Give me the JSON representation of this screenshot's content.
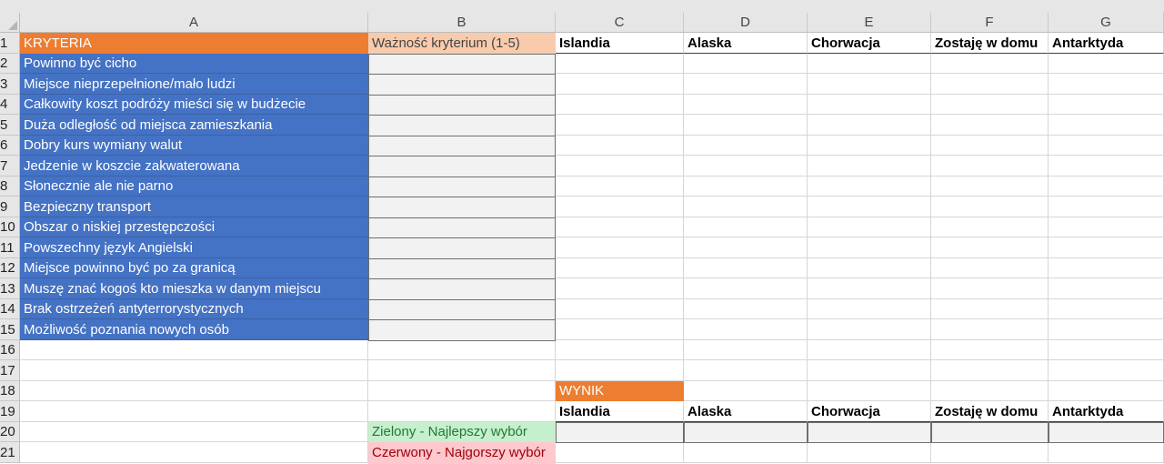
{
  "columns": [
    "A",
    "B",
    "C",
    "D",
    "E",
    "F",
    "G"
  ],
  "rows": [
    "1",
    "2",
    "3",
    "4",
    "5",
    "6",
    "7",
    "8",
    "9",
    "10",
    "11",
    "12",
    "13",
    "14",
    "15",
    "16",
    "17",
    "18",
    "19",
    "20",
    "21"
  ],
  "criteria": {
    "header": "KRYTERIA",
    "items": [
      "Powinno być cicho",
      "Miejsce nieprzepełnione/mało ludzi",
      "Całkowity koszt podróży mieści się w budżecie",
      "Duża odległość od miejsca zamieszkania",
      "Dobry kurs wymiany walut",
      "Jedzenie w koszcie zakwaterowana",
      "Słonecznie ale nie parno",
      "Bezpieczny transport",
      "Obszar o niskiej przestępczości",
      "Powszechny język Angielski",
      "Miejsce powinno być po za granicą",
      "Muszę znać kogoś kto mieszka w danym miejscu",
      "Brak ostrzeżeń antyterrorystycznych",
      "Możliwość poznania nowych osób"
    ]
  },
  "importance_header": "Ważność kryterium (1-5)",
  "destinations": [
    "Islandia",
    "Alaska",
    "Chorwacja",
    "Zostaję w domu",
    "Antarktyda"
  ],
  "result": {
    "label": "WYNIK",
    "destinations": [
      "Islandia",
      "Alaska",
      "Chorwacja",
      "Zostaję w domu",
      "Antarktyda"
    ]
  },
  "legend": {
    "green": "Zielony - Najlepszy wybór",
    "red": "Czerwony - Najgorszy wybór"
  },
  "colors": {
    "criteria_fill": "#4472c4",
    "header_orange": "#ed7d31",
    "importance_fill": "#f8cbad",
    "legend_green": "#c6efce",
    "legend_red": "#ffc7ce"
  }
}
